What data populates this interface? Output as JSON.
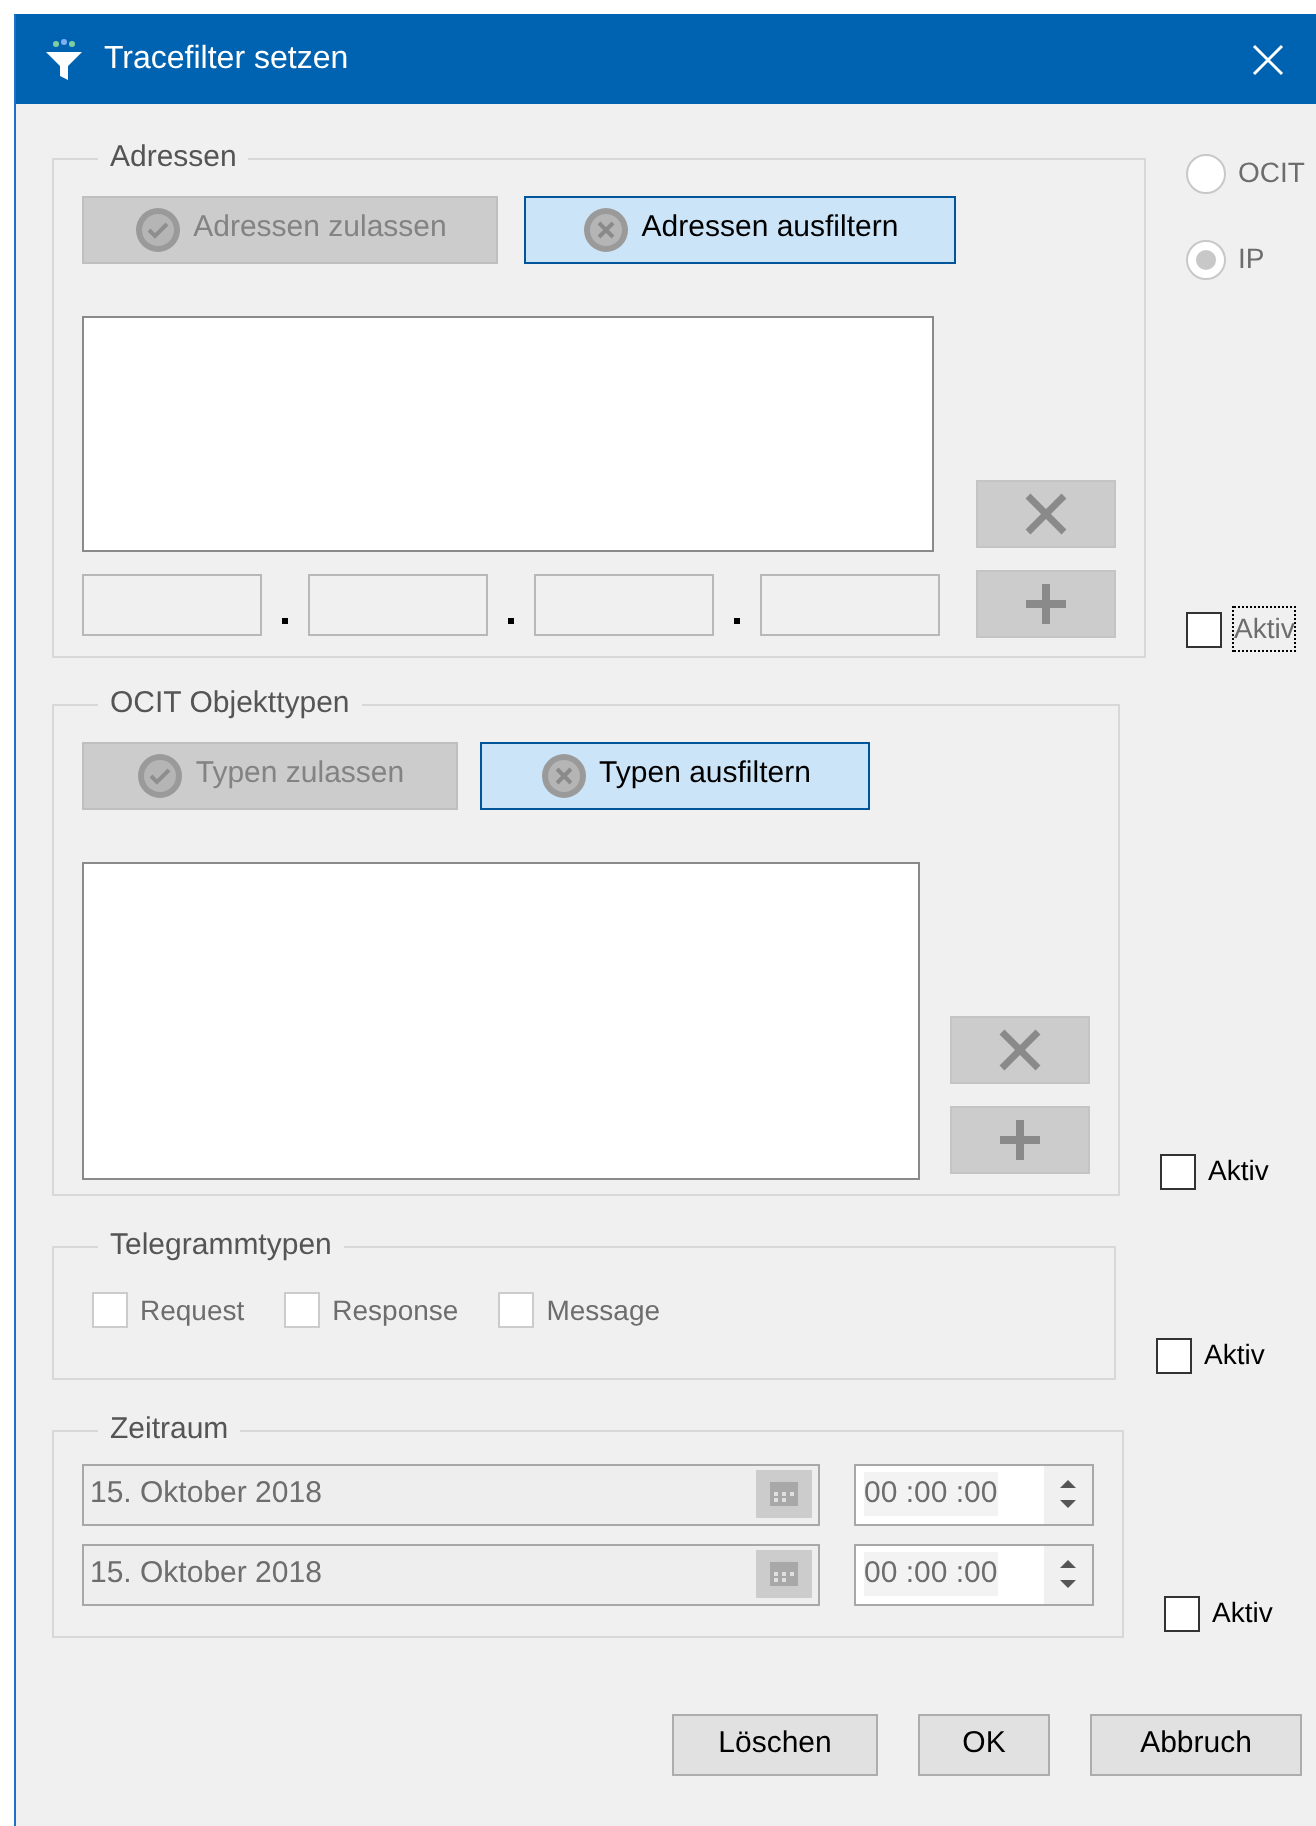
{
  "window": {
    "title": "Tracefilter setzen"
  },
  "address_type": [
    {
      "label": "OCIT",
      "selected": false
    },
    {
      "label": "IP",
      "selected": true
    }
  ],
  "adressen": {
    "legend": "Adressen",
    "modes": [
      {
        "label": "Adressen zulassen",
        "selected": false
      },
      {
        "label": "Adressen ausfiltern",
        "selected": true
      }
    ],
    "aktiv": {
      "label": "Aktiv",
      "checked": false,
      "focused": true
    }
  },
  "objekttypen": {
    "legend": "OCIT Objekttypen",
    "modes": [
      {
        "label": "Typen zulassen",
        "selected": false
      },
      {
        "label": "Typen ausfiltern",
        "selected": true
      }
    ],
    "aktiv": {
      "label": "Aktiv",
      "checked": false,
      "focused": false
    }
  },
  "telegrammtypen": {
    "legend": "Telegrammtypen",
    "options": [
      {
        "label": "Request",
        "checked": false
      },
      {
        "label": "Response",
        "checked": false
      },
      {
        "label": "Message",
        "checked": false
      }
    ],
    "aktiv": {
      "label": "Aktiv",
      "checked": false,
      "focused": false
    }
  },
  "zeitraum": {
    "legend": "Zeitraum",
    "ranges": [
      {
        "date": "15. Oktober 2018",
        "time": "00 :00 :00"
      },
      {
        "date": "15. Oktober 2018",
        "time": "00 :00 :00"
      }
    ],
    "aktiv": {
      "label": "Aktiv",
      "checked": false,
      "focused": false
    }
  },
  "buttons": [
    "Löschen",
    "OK",
    "Abbruch"
  ]
}
